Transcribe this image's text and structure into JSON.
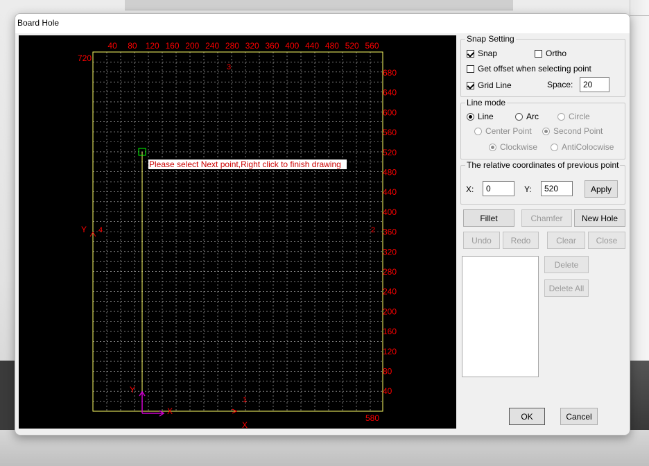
{
  "window": {
    "title": "Board Hole"
  },
  "canvas": {
    "top_ticks": [
      "40",
      "80",
      "120",
      "160",
      "200",
      "240",
      "280",
      "320",
      "360",
      "400",
      "440",
      "480",
      "520",
      "560"
    ],
    "right_ticks": [
      "680",
      "640",
      "600",
      "560",
      "520",
      "480",
      "440",
      "400",
      "360",
      "320",
      "280",
      "240",
      "200",
      "160",
      "120",
      "80",
      "40"
    ],
    "corner_top_left": "720",
    "corner_bottom_right": "580",
    "edge_markers": {
      "top": "3",
      "left": "4",
      "right": "2",
      "bottom": "1"
    },
    "left_axis_label": "Y",
    "bottom_axis_label": "X",
    "origin_y_label": "Y",
    "origin_x_label": "X",
    "hint": "Please select Next point,Right click to finish drawing",
    "colors": {
      "axis": "#ff0000",
      "grid": "#c8c8c8",
      "border": "#ffff66",
      "cursor": "#00ff00",
      "origin": "#cc00cc"
    }
  },
  "snap_setting": {
    "legend": "Snap Setting",
    "snap": {
      "label": "Snap",
      "checked": true
    },
    "ortho": {
      "label": "Ortho",
      "checked": false
    },
    "offset": {
      "label": "Get offset when selecting point",
      "checked": false
    },
    "grid_line": {
      "label": "Grid Line",
      "checked": true
    },
    "space_label": "Space:",
    "space_value": "20"
  },
  "line_mode": {
    "legend": "Line mode",
    "line": "Line",
    "arc": "Arc",
    "circle": "Circle",
    "center_point": "Center Point",
    "second_point": "Second Point",
    "clockwise": "Clockwise",
    "anticlockwise": "AntiColocwise"
  },
  "relative": {
    "legend": "The relative coordinates of previous point",
    "x_label": "X:",
    "x_value": "0",
    "y_label": "Y:",
    "y_value": "520",
    "apply": "Apply"
  },
  "buttons": {
    "fillet": "Fillet",
    "chamfer": "Chamfer",
    "new_hole": "New Hole",
    "undo": "Undo",
    "redo": "Redo",
    "clear": "Clear",
    "close": "Close",
    "delete": "Delete",
    "delete_all": "Delete All",
    "ok": "OK",
    "cancel": "Cancel"
  }
}
